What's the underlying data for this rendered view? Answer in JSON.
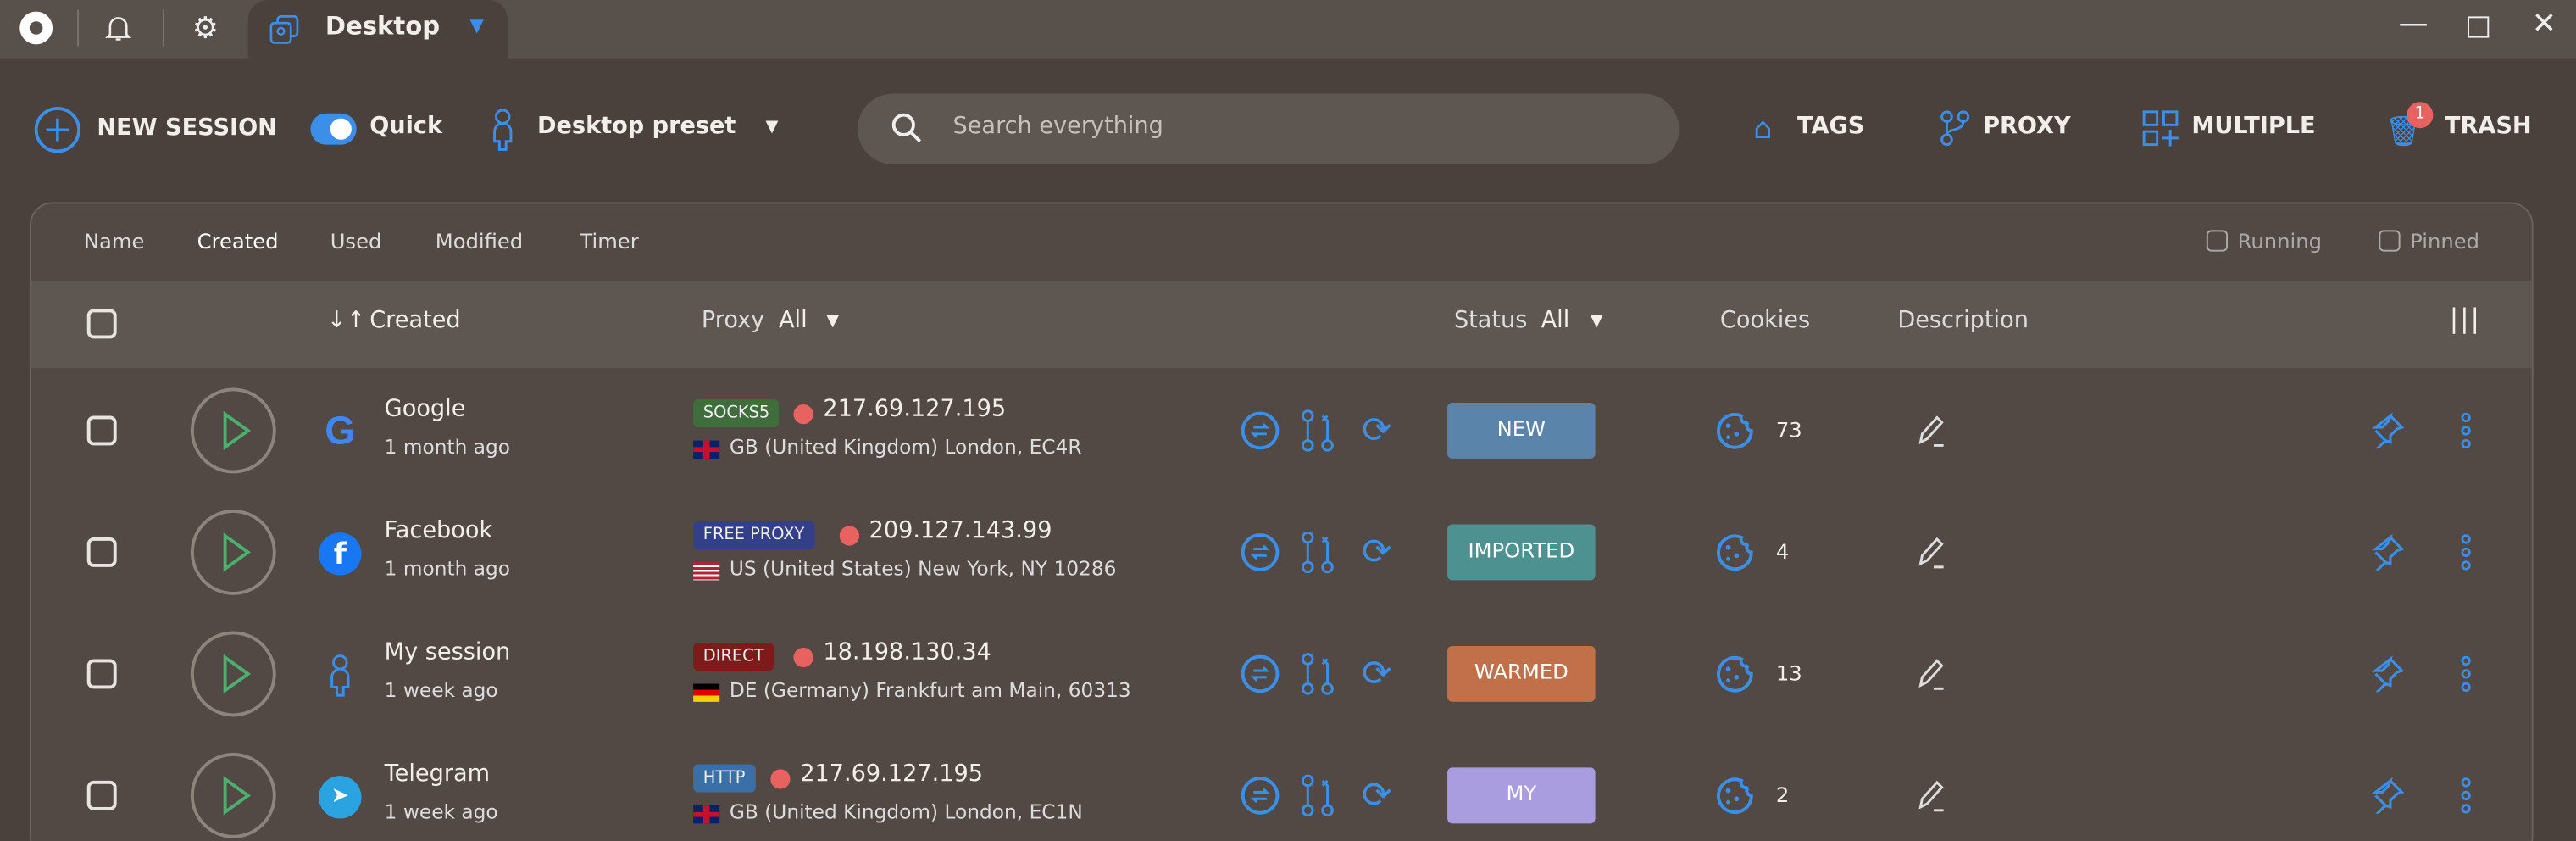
{
  "titlebar": {
    "tab_label": "Desktop"
  },
  "toolbar": {
    "new_session": "NEW SESSION",
    "quick": "Quick",
    "quick_on": true,
    "preset": "Desktop preset",
    "search_placeholder": "Search everything",
    "tags": "TAGS",
    "proxy": "PROXY",
    "multiple": "MULTIPLE",
    "trash": "TRASH",
    "trash_count": "1"
  },
  "sort_tabs": [
    "Name",
    "Created",
    "Used",
    "Modified",
    "Timer"
  ],
  "filters": {
    "running": "Running",
    "pinned": "Pinned"
  },
  "columns": {
    "created": "Created",
    "proxy": "Proxy",
    "proxy_filter": "All",
    "status": "Status",
    "status_filter": "All",
    "cookies": "Cookies",
    "description": "Description"
  },
  "colors": {
    "accent": "#3b8fe8",
    "new": "#5b84ab",
    "imported": "#4e9191",
    "warmed": "#c2704a",
    "my": "#a99de0"
  },
  "rows": [
    {
      "name": "Google",
      "time": "1 month ago",
      "icon": "google-icon",
      "proxy_type": "SOCKS5",
      "proxy_color": "#3f6e3c",
      "ip": "217.69.127.195",
      "location": "GB (United Kingdom) London, EC4R",
      "flag": "gb",
      "status": "NEW",
      "status_color": "#5b84ab",
      "cookies": "73"
    },
    {
      "name": "Facebook",
      "time": "1 month ago",
      "icon": "facebook-icon",
      "proxy_type": "FREE PROXY",
      "proxy_color": "#343f8a",
      "ip": "209.127.143.99",
      "location": "US (United States) New York, NY 10286",
      "flag": "us",
      "status": "IMPORTED",
      "status_color": "#4e9191",
      "cookies": "4"
    },
    {
      "name": "My session",
      "time": "1 week ago",
      "icon": "person-icon",
      "proxy_type": "DIRECT",
      "proxy_color": "#7d1a1a",
      "ip": "18.198.130.34",
      "location": "DE (Germany) Frankfurt am Main, 60313",
      "flag": "de",
      "status": "WARMED",
      "status_color": "#c2704a",
      "cookies": "13"
    },
    {
      "name": "Telegram",
      "time": "1 week ago",
      "icon": "telegram-icon",
      "proxy_type": "HTTP",
      "proxy_color": "#3a6fa8",
      "ip": "217.69.127.195",
      "location": "GB (United Kingdom) London, EC1N",
      "flag": "gb",
      "status": "MY",
      "status_color": "#a99de0",
      "cookies": "2"
    }
  ]
}
